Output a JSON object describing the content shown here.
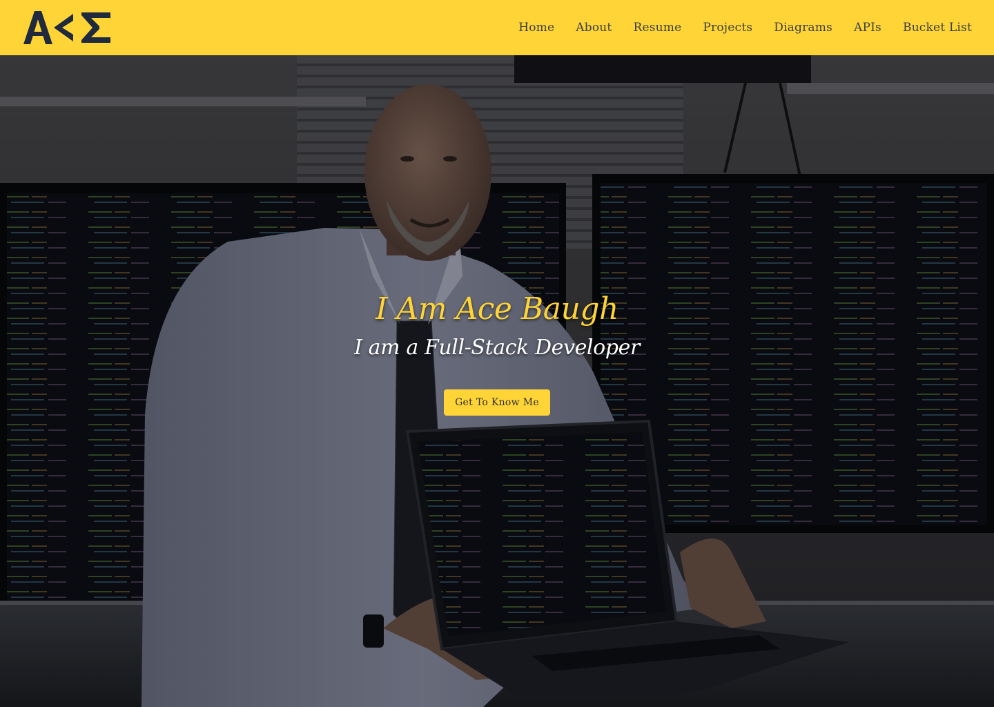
{
  "brand": {
    "logo_text": "A<Σ",
    "logo_color": "#1f2a3c"
  },
  "nav": {
    "items": [
      {
        "label": "Home"
      },
      {
        "label": "About"
      },
      {
        "label": "Resume"
      },
      {
        "label": "Projects"
      },
      {
        "label": "Diagrams"
      },
      {
        "label": "APIs"
      },
      {
        "label": "Bucket List"
      }
    ]
  },
  "hero": {
    "title": "I Am Ace Baugh",
    "subtitle": "I am a Full-Stack Developer",
    "cta_label": "Get To Know Me",
    "photo_description_icon": "portrait-photo",
    "accent_color": "#fed436"
  }
}
